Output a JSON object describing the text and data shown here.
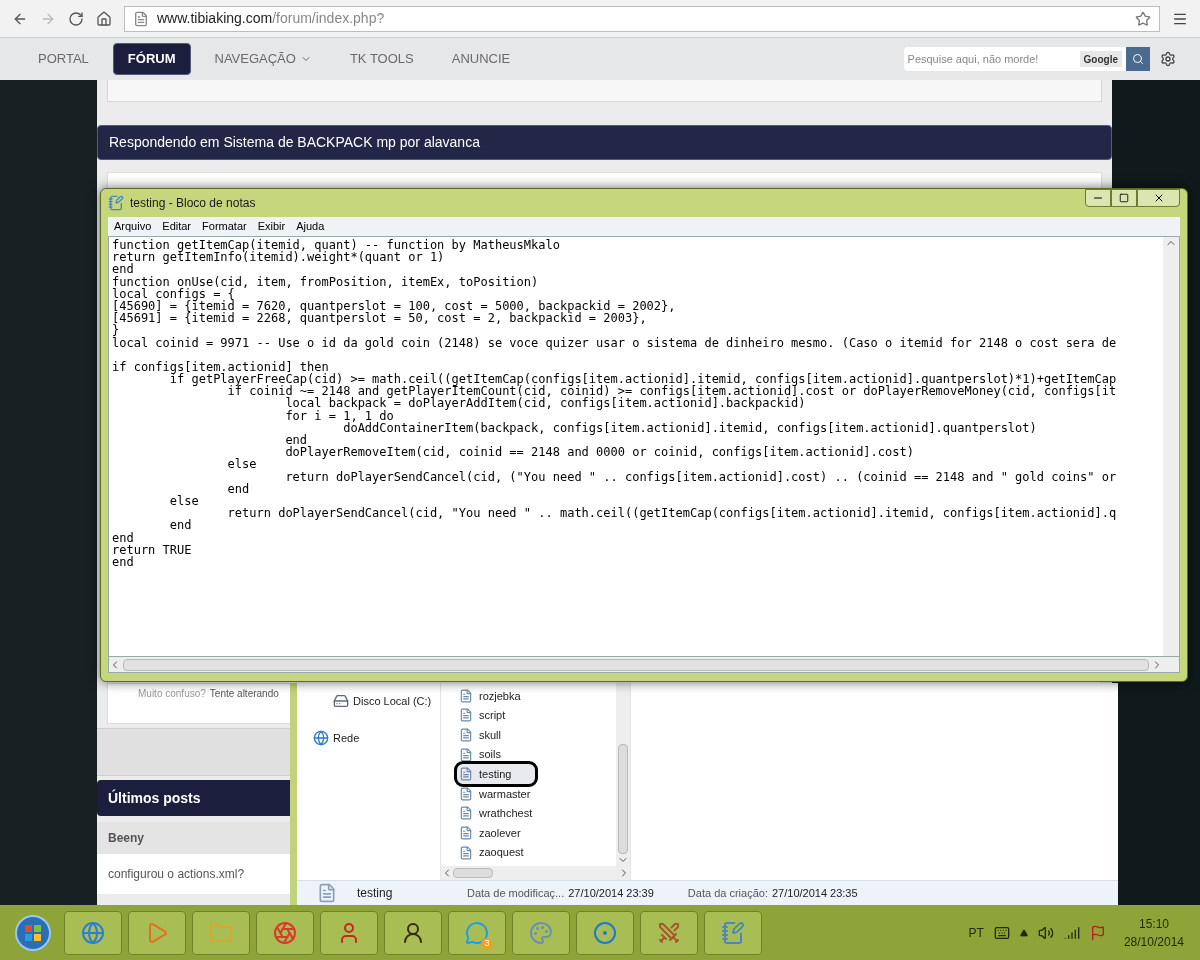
{
  "browser": {
    "url_host": "www.tibiaking.com",
    "url_path": "/forum/index.php?"
  },
  "nav": {
    "items": [
      {
        "label": "PORTAL",
        "selected": false,
        "has_menu": false
      },
      {
        "label": "FÓRUM",
        "selected": true,
        "has_menu": false
      },
      {
        "label": "NAVEGAÇÃO",
        "selected": false,
        "has_menu": true
      },
      {
        "label": "TK TOOLS",
        "selected": false,
        "has_menu": false
      },
      {
        "label": "ANUNCIE",
        "selected": false,
        "has_menu": false
      }
    ],
    "search": {
      "placeholder": "Pesquise aqui, não morde!",
      "badge": "Google"
    }
  },
  "page": {
    "reply_header": "Respondendo em Sistema de BACKPACK mp por alavanca",
    "hint": {
      "muted": "Muito confuso?",
      "link": "Tente alterando"
    },
    "latest_posts": {
      "title": "Últimos posts",
      "author": "Beeny",
      "excerpt": "configurou o actions.xml?"
    }
  },
  "notepad": {
    "title": "testing - Bloco de notas",
    "menu": [
      "Arquivo",
      "Editar",
      "Formatar",
      "Exibir",
      "Ajuda"
    ],
    "blocks": [
      [
        "function getItemCap(itemid, quant) -- function by MatheusMkalo",
        "return getItemInfo(itemid).weight*(quant or 1)",
        "end",
        "function onUse(cid, item, fromPosition, itemEx, toPosition)",
        "local configs = {",
        "[45690] = {itemid = 7620, quantperslot = 100, cost = 5000, backpackid = 2002},",
        "[45691] = {itemid = 2268, quantperslot = 50, cost = 2, backpackid = 2003},",
        "}",
        "local coinid = 9971 -- Use o id da gold coin (2148) se voce quizer usar o sistema de dinheiro mesmo. (Caso o itemid for 2148 o cost sera de"
      ],
      [
        "if configs[item.actionid] then",
        "\tif getPlayerFreeCap(cid) >= math.ceil((getItemCap(configs[item.actionid].itemid, configs[item.actionid].quantperslot)*1)+getItemCap",
        "\t\tif coinid ~= 2148 and getPlayerItemCount(cid, coinid) >= configs[item.actionid].cost or doPlayerRemoveMoney(cid, configs[it",
        "\t\t\tlocal backpack = doPlayerAddItem(cid, configs[item.actionid].backpackid)",
        "\t\t\tfor i = 1, 1 do",
        "\t\t\t\tdoAddContainerItem(backpack, configs[item.actionid].itemid, configs[item.actionid].quantperslot)",
        "\t\t\tend",
        "\t\t\tdoPlayerRemoveItem(cid, coinid == 2148 and 0000 or coinid, configs[item.actionid].cost)",
        "\t\telse",
        "\t\t\treturn doPlayerSendCancel(cid, (\"You need \" .. configs[item.actionid].cost) .. (coinid == 2148 and \" gold coins\" or",
        "\t\tend",
        "\telse",
        "\t\treturn doPlayerSendCancel(cid, \"You need \" .. math.ceil((getItemCap(configs[item.actionid].itemid, configs[item.actionid].q",
        "\tend",
        "end",
        "return TRUE",
        "end"
      ]
    ]
  },
  "explorer": {
    "nav": [
      {
        "label": "Disco Local (C:)",
        "kind": "drive"
      },
      {
        "label": "Rede",
        "kind": "network"
      }
    ],
    "files": [
      {
        "name": "rozjebka",
        "selected": false
      },
      {
        "name": "script",
        "selected": false
      },
      {
        "name": "skull",
        "selected": false
      },
      {
        "name": "soils",
        "selected": false
      },
      {
        "name": "testing",
        "selected": true
      },
      {
        "name": "warmaster",
        "selected": false
      },
      {
        "name": "wrathchest",
        "selected": false
      },
      {
        "name": "zaolever",
        "selected": false
      },
      {
        "name": "zaoquest",
        "selected": false
      }
    ],
    "details": {
      "name": "testing",
      "modified_label": "Data de modificaç...",
      "modified": "27/10/2014 23:39",
      "created_label": "Data da criação:",
      "created": "27/10/2014 23:35"
    }
  },
  "taskbar": {
    "apps": [
      {
        "kind": "start"
      },
      {
        "kind": "globe"
      },
      {
        "kind": "play"
      },
      {
        "kind": "folder"
      },
      {
        "kind": "round"
      },
      {
        "kind": "character"
      },
      {
        "kind": "person"
      },
      {
        "kind": "chat",
        "badge": "3"
      },
      {
        "kind": "palette"
      },
      {
        "kind": "dots"
      },
      {
        "kind": "swords"
      },
      {
        "kind": "notepad"
      }
    ],
    "tray": {
      "language": "PT",
      "time": "15:10",
      "date": "28/10/2014"
    }
  }
}
